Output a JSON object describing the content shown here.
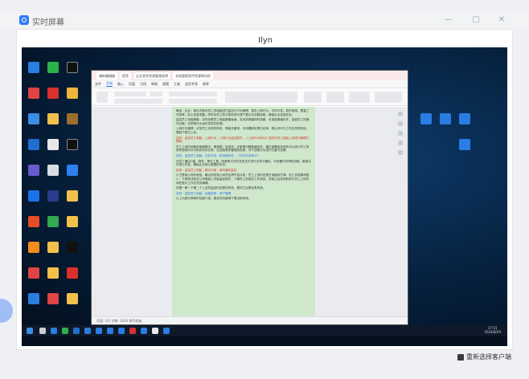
{
  "viewer": {
    "title": "实时屏幕",
    "remote_device_name": "Ilyn",
    "reselect_label": "重新选择客户端",
    "controls": {
      "minimize": "—",
      "maximize": "□",
      "close": "✕"
    }
  },
  "word_app": {
    "tabs": [
      "福昕编辑器",
      "稻壳",
      "企业宣传资源管理说明",
      "文档管理宣传资源和风险"
    ],
    "menu": [
      "文件",
      "开始",
      "插入",
      "页面",
      "引用",
      "审阅",
      "视图",
      "工具",
      "会员专享",
      "效率"
    ],
    "active_menu": "开始",
    "status_text": "页面: 1/2    字数: 1024    拼写检查",
    "paragraphs": [
      {
        "style": "normal",
        "text": "概述 - 企业、单位内部对员工的电脑进行监控与行为管理，规范上网行为、文件外发、软件使用，提高工作效率，防止机密泄露。同时对员工的计算机进行资产登记与远程协助，确保企业信息安全。"
      },
      {
        "style": "normal",
        "text": "监控员工电脑屏幕 - 实时查看员工电脑屏幕画面，支持多屏幕同时观看，可录制屏幕历史，回放员工的操作过程，对异常行为及时发现并处理。"
      },
      {
        "style": "normal",
        "text": "上网行为管理 - 记录员工浏览的网页、搜索关键词，可设置网址黑白名单，禁止访问与工作无关的网站，限制下载与上传。"
      },
      {
        "style": "red",
        "text": "如何 - 监控员工电脑 - 上网行为 - 上网行为监控软件 - 《上网行为审计》如何对员工电脑上网进行管理与限制。"
      },
      {
        "style": "normal",
        "text": "员工上班时间使用电脑聊天、看视频、玩游戏、炒股等问题普遍存在，通过部署监控软件可以统计员工的软件使用时长与网页访问记录，生成报表供管理层查看，对于违规行为进行拦截与告警。"
      },
      {
        "style": "blue",
        "text": "如何 - 监控员工电脑 - 文件外发 - 防泄密软件 - 《文件外发审计》"
      },
      {
        "style": "normal",
        "text": "对员工通过U盘、邮件、聊天工具、网盘等方式外发的文件进行记录与备份，可设置外发审批流程，敏感文件禁止外发，确保企业核心数据的安全。"
      },
      {
        "style": "red",
        "text": "如何 - 监控员工电脑 - 聊天记录 - 即时通讯监控"
      },
      {
        "style": "normal",
        "text": "小王是某公司的老板，最近他发现公司的业绩不如从前，员工上班时总是在电脑前忙碌，但工作成果却很少，于是他决定在公司电脑上安装监控软件，了解员工的真实工作状态。安装之后发现有部分员工上班时间在做与工作无关的事情。"
      },
      {
        "style": "normal",
        "text": "在看一看一下第二个上文的监控内容是否有效，看完之后是否有改进。"
      },
      {
        "style": "blue",
        "text": "如何 - 监控员工电脑 - 远程协助 - 资产管理"
      },
      {
        "style": "normal",
        "text": "以上为部分简单的功能介绍，更多的功能请下载试用体验。"
      }
    ]
  },
  "taskbar": {
    "time": "17:01",
    "date": "2024/8/29"
  }
}
